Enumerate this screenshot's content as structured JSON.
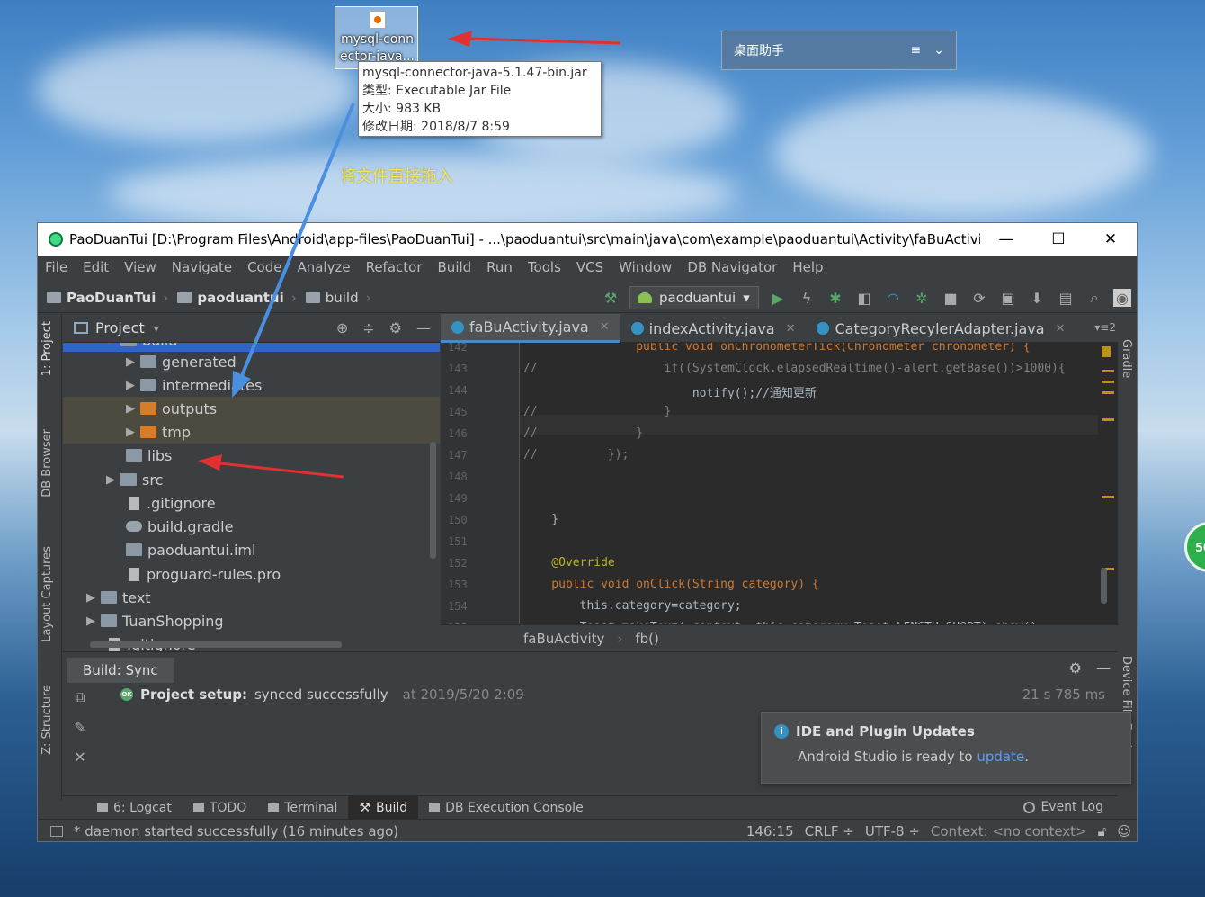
{
  "desktop": {
    "icon_caption": "mysql-connector-java...",
    "tooltip": {
      "name": "mysql-connector-java-5.1.47-bin.jar",
      "type": "类型: Executable Jar File",
      "size": "大小: 983 KB",
      "modified": "修改日期: 2018/8/7 8:59"
    },
    "assistant_label": "桌面助手",
    "hint_text": "将文件直接拖入",
    "badge_text": "50"
  },
  "window": {
    "title": "PaoDuanTui [D:\\Program Files\\Android\\app-files\\PaoDuanTui] - ...\\paoduantui\\src\\main\\java\\com\\example\\paoduantui\\Activity\\faBuActivi..."
  },
  "menu": [
    "File",
    "Edit",
    "View",
    "Navigate",
    "Code",
    "Analyze",
    "Refactor",
    "Build",
    "Run",
    "Tools",
    "VCS",
    "Window",
    "DB Navigator",
    "Help"
  ],
  "breadcrumbs": [
    "PaoDuanTui",
    "paoduantui",
    "build"
  ],
  "run_config": "paoduantui",
  "left_tabs": [
    "1: Project",
    "DB Browser",
    "Layout Captures",
    "Z: Structure"
  ],
  "right_tabs": [
    "Gradle",
    "Device File Explorer"
  ],
  "project": {
    "title": "Project",
    "tree": [
      {
        "label": "build",
        "indent": 3
      },
      {
        "label": "generated",
        "indent": 4
      },
      {
        "label": "intermediates",
        "indent": 4
      },
      {
        "label": "outputs",
        "indent": 4
      },
      {
        "label": "tmp",
        "indent": 4
      },
      {
        "label": "libs",
        "indent": 3
      },
      {
        "label": "src",
        "indent": 3
      },
      {
        "label": ".gitignore",
        "indent": 3
      },
      {
        "label": "build.gradle",
        "indent": 3
      },
      {
        "label": "paoduantui.iml",
        "indent": 3
      },
      {
        "label": "proguard-rules.pro",
        "indent": 3
      },
      {
        "label": "text",
        "indent": 2
      },
      {
        "label": "TuanShopping",
        "indent": 2
      },
      {
        "label": ".gitignore",
        "indent": 2
      }
    ]
  },
  "editor": {
    "tabs": [
      "faBuActivity.java",
      "indexActivity.java",
      "CategoryRecylerAdapter.java"
    ],
    "tab_count": "2",
    "lines": [
      {
        "n": "142",
        "text": "                public void onChronometerTick(Chronometer chronometer) {"
      },
      {
        "n": "143",
        "text": "//                  if((SystemClock.elapsedRealtime()-alert.getBase())>1000){"
      },
      {
        "n": "144",
        "text": "                        notify();//通知更新"
      },
      {
        "n": "145",
        "text": "//                  }"
      },
      {
        "n": "146",
        "text": "//              }"
      },
      {
        "n": "147",
        "text": "//          });"
      },
      {
        "n": "148",
        "text": ""
      },
      {
        "n": "149",
        "text": ""
      },
      {
        "n": "150",
        "text": "    }"
      },
      {
        "n": "151",
        "text": ""
      },
      {
        "n": "152",
        "text": "    @Override"
      },
      {
        "n": "153",
        "text": "    public void onClick(String category) {"
      },
      {
        "n": "154",
        "text": "        this.category=category;"
      },
      {
        "n": "155",
        "text": "        Toast.makeText( context: this,category,Toast.LENGTH_SHORT).show();"
      }
    ],
    "crumbs": [
      "faBuActivity",
      "fb()"
    ]
  },
  "build": {
    "tab": "Build: Sync",
    "message_bold": "Project setup:",
    "message": "synced successfully",
    "timestamp": "at 2019/5/20 2:09",
    "duration": "21 s 785 ms",
    "notification": {
      "title": "IDE and Plugin Updates",
      "body": "Android Studio is ready to",
      "link": "update",
      "after": "."
    }
  },
  "bottom_tools": [
    "6: Logcat",
    "TODO",
    "Terminal",
    "Build",
    "DB Execution Console"
  ],
  "event_log": "Event Log",
  "status": {
    "message": "* daemon started successfully (16 minutes ago)",
    "position": "146:15",
    "line_sep": "CRLF ÷",
    "encoding": "UTF-8 ÷",
    "context": "Context: <no context>"
  }
}
